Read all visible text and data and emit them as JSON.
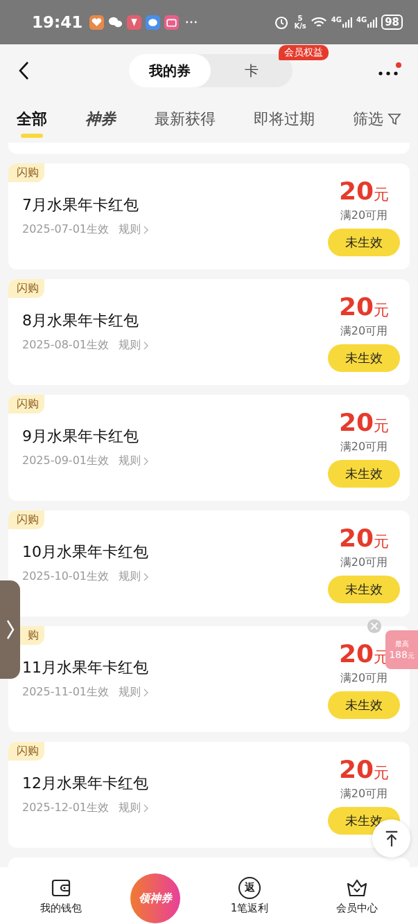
{
  "status_bar": {
    "time": "19:41",
    "speed_value": "5",
    "speed_unit": "K/s",
    "network_1": "4G",
    "network_2": "4G",
    "battery": "98"
  },
  "header": {
    "segments": [
      {
        "label": "我的券",
        "selected": true
      },
      {
        "label": "卡",
        "selected": false
      }
    ],
    "badge": "会员权益",
    "more_dot": true
  },
  "tabs": [
    {
      "label": "全部",
      "selected": true,
      "kind": "text"
    },
    {
      "label": "神券",
      "selected": false,
      "kind": "brand"
    },
    {
      "label": "最新获得",
      "selected": false,
      "kind": "text"
    },
    {
      "label": "即将过期",
      "selected": false,
      "kind": "text"
    },
    {
      "label": "筛选",
      "selected": false,
      "kind": "filter"
    }
  ],
  "coupons": [
    {
      "tag": "闪购",
      "title": "7月水果年卡红包",
      "date": "2025-07-01生效",
      "rule": "规则",
      "amount": "20",
      "unit": "元",
      "condition": "满20可用",
      "status": "未生效"
    },
    {
      "tag": "闪购",
      "title": "8月水果年卡红包",
      "date": "2025-08-01生效",
      "rule": "规则",
      "amount": "20",
      "unit": "元",
      "condition": "满20可用",
      "status": "未生效"
    },
    {
      "tag": "闪购",
      "title": "9月水果年卡红包",
      "date": "2025-09-01生效",
      "rule": "规则",
      "amount": "20",
      "unit": "元",
      "condition": "满20可用",
      "status": "未生效"
    },
    {
      "tag": "闪购",
      "title": "10月水果年卡红包",
      "date": "2025-10-01生效",
      "rule": "规则",
      "amount": "20",
      "unit": "元",
      "condition": "满20可用",
      "status": "未生效"
    },
    {
      "tag": "购",
      "title": "11月水果年卡红包",
      "date": "2025-11-01生效",
      "rule": "规则",
      "amount": "20",
      "unit": "元",
      "condition": "满20可用",
      "status": "未生效"
    },
    {
      "tag": "闪购",
      "title": "12月水果年卡红包",
      "date": "2025-12-01生效",
      "rule": "规则",
      "amount": "20",
      "unit": "元",
      "condition": "满20可用",
      "status": "未生效"
    }
  ],
  "promo_float": {
    "top": "最高",
    "amount": "188",
    "unit": "元"
  },
  "bottom_nav": [
    {
      "label": "我的钱包",
      "kind": "wallet"
    },
    {
      "label": "领神券",
      "kind": "center"
    },
    {
      "label": "1笔返利",
      "kind": "rebate",
      "icon_text": "返"
    },
    {
      "label": "会员中心",
      "kind": "crown"
    }
  ]
}
